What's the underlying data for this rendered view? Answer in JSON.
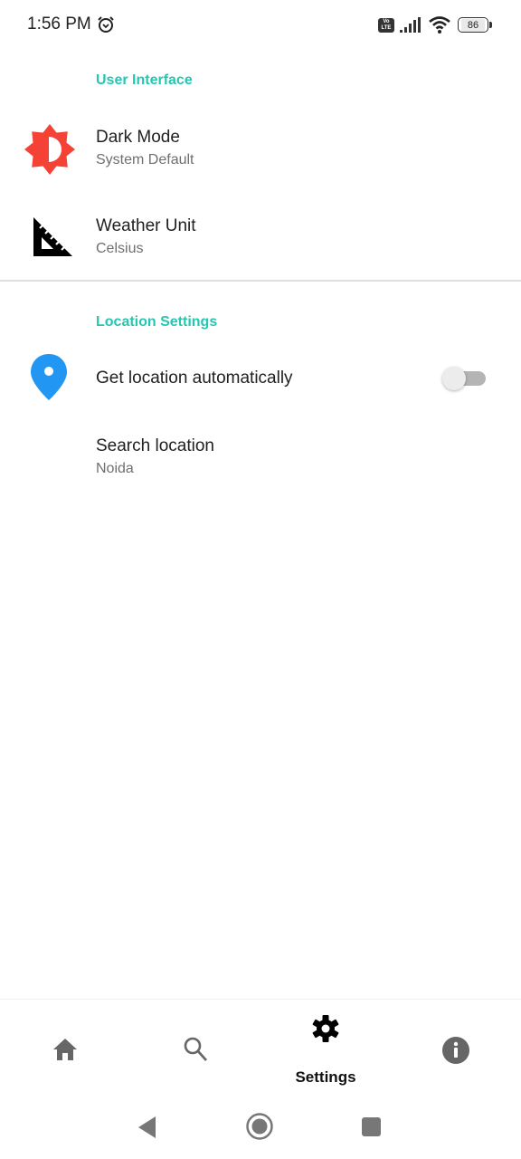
{
  "status_bar": {
    "time": "1:56 PM",
    "alarm_icon": "alarm-clock-icon",
    "volte_label": "Vo LTE",
    "signal_icon": "cell-signal-icon",
    "wifi_icon": "wifi-icon",
    "battery_level": "86"
  },
  "sections": [
    {
      "header": "User Interface",
      "items": [
        {
          "title": "Dark Mode",
          "summary": "System Default",
          "icon": "brightness-icon",
          "icon_color": "#f44336"
        },
        {
          "title": "Weather Unit",
          "summary": "Celsius",
          "icon": "set-square-ruler-icon",
          "icon_color": "#000000"
        }
      ]
    },
    {
      "header": "Location Settings",
      "items": [
        {
          "title": "Get location automatically",
          "icon": "location-pin-icon",
          "icon_color": "#2196f3",
          "toggle_on": false
        },
        {
          "title": "Search location",
          "summary": "Noida"
        }
      ]
    }
  ],
  "bottom_nav": {
    "items": [
      {
        "name": "home",
        "icon": "home-icon",
        "label": "",
        "selected": false
      },
      {
        "name": "search",
        "icon": "search-icon",
        "label": "",
        "selected": false
      },
      {
        "name": "settings",
        "icon": "gear-icon",
        "label": "Settings",
        "selected": true
      },
      {
        "name": "info",
        "icon": "info-icon",
        "label": "",
        "selected": false
      }
    ]
  },
  "system_nav": {
    "back": "back-triangle-icon",
    "home": "home-circle-icon",
    "recents": "recents-square-icon"
  },
  "colors": {
    "accent": "#26c6b2",
    "nav_inactive": "#666666",
    "nav_active": "#111111"
  }
}
